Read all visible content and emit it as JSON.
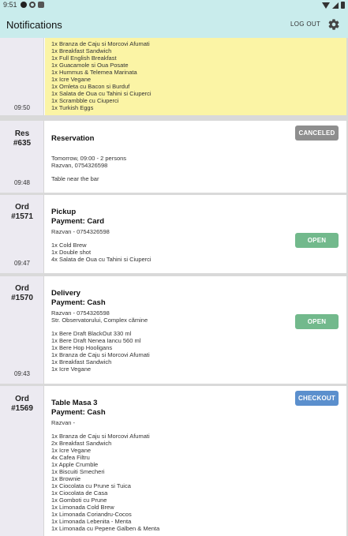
{
  "status_bar": {
    "time": "9:51"
  },
  "app_bar": {
    "title": "Notifications",
    "logout_label": "LOG OUT"
  },
  "orders": [
    {
      "time": "09:50",
      "items": [
        "1x Branza de Caju si Morcovi Afumati",
        "1x Breakfast Sandwich",
        "1x Full English Breakfast",
        "1x Guacamole si Oua Posate",
        "1x Hummus & Telemea Marinata",
        "1x Icre Vegane",
        "1x Omleta cu Bacon si Burduf",
        "1x Salata de Oua cu Tahini si Ciuperci",
        "1x Scrambble cu Ciuperci",
        "1x Turkish Eggs"
      ]
    },
    {
      "kind": "Res",
      "number": "#635",
      "time": "09:48",
      "status": "CANCELED",
      "title": "Reservation",
      "details": [
        "Tomorrow, 09:00 - 2 persons",
        "Razvan, 0754326598"
      ],
      "note": "Table near the bar"
    },
    {
      "kind": "Ord",
      "number": "#1571",
      "time": "09:47",
      "status": "OPEN",
      "title": "Pickup",
      "payment": "Payment: Card",
      "details": [
        "Razvan - 0754326598"
      ],
      "items": [
        "1x Cold Brew",
        "1x Double shot",
        "4x Salata de Oua cu Tahini si Ciuperci"
      ]
    },
    {
      "kind": "Ord",
      "number": "#1570",
      "time": "09:43",
      "status": "OPEN",
      "title": "Delivery",
      "payment": "Payment: Cash",
      "details": [
        "Razvan - 0754326598",
        "Str. Observatorului, Complex cămine"
      ],
      "items": [
        "1x Bere Draft BlackOut 330 ml",
        "1x Bere Draft Nenea Iancu 560 ml",
        "1x Bere Hop Hooligans",
        "1x Branza de Caju si Morcovi Afumati",
        "1x Breakfast Sandwich",
        "1x Icre Vegane"
      ]
    },
    {
      "kind": "Ord",
      "number": "#1569",
      "status": "CHECKOUT",
      "title": "Table Masa 3",
      "payment": "Payment: Cash",
      "details": [
        "Razvan -"
      ],
      "items": [
        "1x Branza de Caju si Morcovi Afumati",
        "2x Breakfast Sandwich",
        "1x Icre Vegane",
        "4x Cafea Filtru",
        "1x Apple Crumble",
        "1x Biscuiti Smecheri",
        "1x Brownie",
        "1x Ciocolata cu Prune si Tuica",
        "1x Ciocolata de Casa",
        "1x Gomboti cu Prune",
        "1x Limonada Cold Brew",
        "1x Limonada Coriandru-Cocos",
        "1x Limonada Lebenita - Menta",
        "1x Limonada cu Pepene Galben & Menta"
      ]
    }
  ]
}
